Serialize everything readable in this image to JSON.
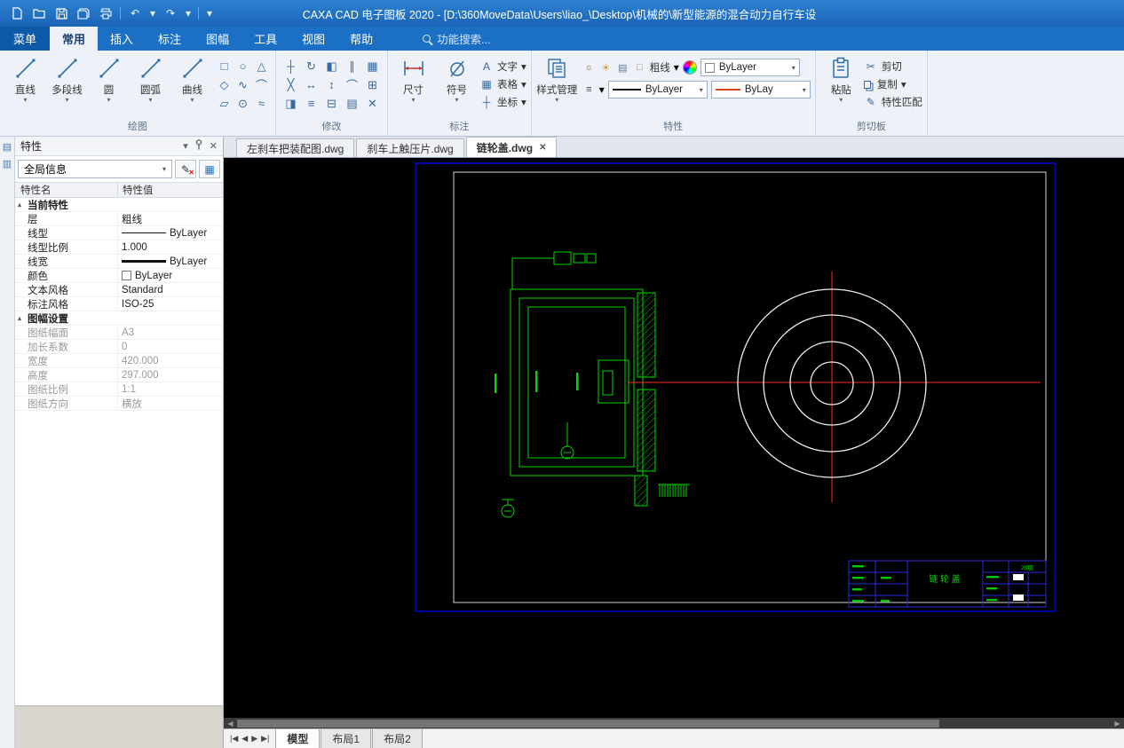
{
  "titlebar": {
    "title": "CAXA CAD 电子图板 2020 - [D:\\360MoveData\\Users\\liao_\\Desktop\\机械的\\新型能源的混合动力自行车设"
  },
  "menubar": {
    "menu_button": "菜单",
    "tabs": [
      {
        "label": "常用",
        "active": true
      },
      {
        "label": "插入"
      },
      {
        "label": "标注"
      },
      {
        "label": "图幅"
      },
      {
        "label": "工具"
      },
      {
        "label": "视图"
      },
      {
        "label": "帮助"
      }
    ],
    "search_placeholder": "功能搜索..."
  },
  "ribbon": {
    "draw": {
      "label": "绘图",
      "big_tools": [
        {
          "label": "直线",
          "icon": "line-icon"
        },
        {
          "label": "多段线",
          "icon": "polyline-icon"
        },
        {
          "label": "圆",
          "icon": "circle-icon"
        },
        {
          "label": "圆弧",
          "icon": "arc-icon"
        },
        {
          "label": "曲线",
          "icon": "spline-icon"
        }
      ],
      "small_tools": [
        {
          "name": "rectangle-icon",
          "glyph": "□"
        },
        {
          "name": "ellipse-icon",
          "glyph": "○"
        },
        {
          "name": "polygon-icon",
          "glyph": "△"
        },
        {
          "name": "rhombus-icon",
          "glyph": "◇"
        },
        {
          "name": "wavecurve-icon",
          "glyph": "∿"
        },
        {
          "name": "arc-small-icon",
          "glyph": "⌒"
        },
        {
          "name": "parallelogram-icon",
          "glyph": "▱"
        },
        {
          "name": "point-icon",
          "glyph": "⊙"
        },
        {
          "name": "equidistant-icon",
          "glyph": "≈"
        }
      ]
    },
    "modify": {
      "label": "修改",
      "tools": [
        {
          "name": "move-icon",
          "glyph": "┼"
        },
        {
          "name": "rotate-icon",
          "glyph": "↻"
        },
        {
          "name": "mirror-icon",
          "glyph": "◧"
        },
        {
          "name": "offset-icon",
          "glyph": "∥"
        },
        {
          "name": "array-icon",
          "glyph": "▦"
        },
        {
          "name": "erase-icon",
          "glyph": "╳"
        },
        {
          "name": "stretch-icon",
          "glyph": "↔"
        },
        {
          "name": "scale-icon",
          "glyph": "↕"
        },
        {
          "name": "fillet-icon",
          "glyph": "⌒"
        },
        {
          "name": "extend-icon",
          "glyph": "⊞"
        },
        {
          "name": "trim-icon",
          "glyph": "◨"
        },
        {
          "name": "align-icon",
          "glyph": "≡"
        },
        {
          "name": "break-icon",
          "glyph": "⊟"
        },
        {
          "name": "hatch-icon",
          "glyph": "▤"
        },
        {
          "name": "delete-icon",
          "glyph": "✕"
        }
      ]
    },
    "annotate": {
      "label": "标注",
      "big_tools": [
        {
          "label": "尺寸",
          "icon": "dimension-icon"
        },
        {
          "label": "符号",
          "icon": "symbol-icon"
        }
      ],
      "rows": [
        {
          "label": "文字",
          "glyph": "A"
        },
        {
          "label": "表格",
          "glyph": "▦"
        },
        {
          "label": "坐标",
          "glyph": "┼"
        }
      ]
    },
    "props": {
      "label": "特性",
      "style_manager": "样式管理",
      "layer_name": "粗线",
      "color_value": "ByLayer",
      "linetype_value": "ByLayer",
      "lineweight_value": "ByLay"
    },
    "clipboard": {
      "label": "剪切板",
      "paste": "粘贴",
      "cut": "剪切",
      "copy": "复制",
      "match": "特性匹配"
    }
  },
  "doc_tabs": [
    {
      "label": "左刹车把装配图.dwg"
    },
    {
      "label": "刹车上触压片.dwg"
    },
    {
      "label": "链轮盖.dwg",
      "active": true
    }
  ],
  "properties_panel": {
    "title": "特性",
    "scope_selector": "全局信息",
    "col_name": "特性名",
    "col_value": "特性值",
    "rows": [
      {
        "name": "当前特性",
        "value": "",
        "group": true
      },
      {
        "name": "层",
        "value": "粗线"
      },
      {
        "name": "线型",
        "value": "ByLayer",
        "swatch": "line"
      },
      {
        "name": "线型比例",
        "value": "1.000"
      },
      {
        "name": "线宽",
        "value": "ByLayer",
        "swatch": "thick"
      },
      {
        "name": "颜色",
        "value": "ByLayer",
        "swatch": "color"
      },
      {
        "name": "文本风格",
        "value": "Standard"
      },
      {
        "name": "标注风格",
        "value": "ISO-25"
      },
      {
        "name": "图幅设置",
        "value": "",
        "group": true
      },
      {
        "name": "图纸幅面",
        "value": "A3",
        "dim": true
      },
      {
        "name": "加长系数",
        "value": "0",
        "dim": true
      },
      {
        "name": "宽度",
        "value": "420.000",
        "dim": true
      },
      {
        "name": "高度",
        "value": "297.000",
        "dim": true
      },
      {
        "name": "图纸比例",
        "value": "1:1",
        "dim": true
      },
      {
        "name": "图纸方向",
        "value": "横放",
        "dim": true
      }
    ]
  },
  "canvas": {
    "part_name": "链 轮 盖",
    "material": "20钢"
  },
  "layout_bar": {
    "nav": [
      "|◀",
      "◀",
      "▶",
      "▶|"
    ],
    "tabs": [
      {
        "label": "模型",
        "active": true
      },
      {
        "label": "布局1"
      },
      {
        "label": "布局2"
      }
    ]
  },
  "icons": {
    "close": "✕",
    "dropdown": "▾",
    "expander": "▴",
    "undo": "↶",
    "redo": "↷",
    "bulb": "☼",
    "sun": "☀",
    "printer": "▤",
    "lock": "□",
    "menu_lines": "≡",
    "cut": "✂",
    "match": "✎",
    "edit": "✎",
    "grid": "▦",
    "panel_tab1": "▤",
    "panel_tab2": "▥"
  },
  "colors": {
    "accent_blue": "#1b70c5",
    "cad_green": "#00d800",
    "cad_red": "#ff2a2a",
    "frame_blue": "#0000d9"
  }
}
